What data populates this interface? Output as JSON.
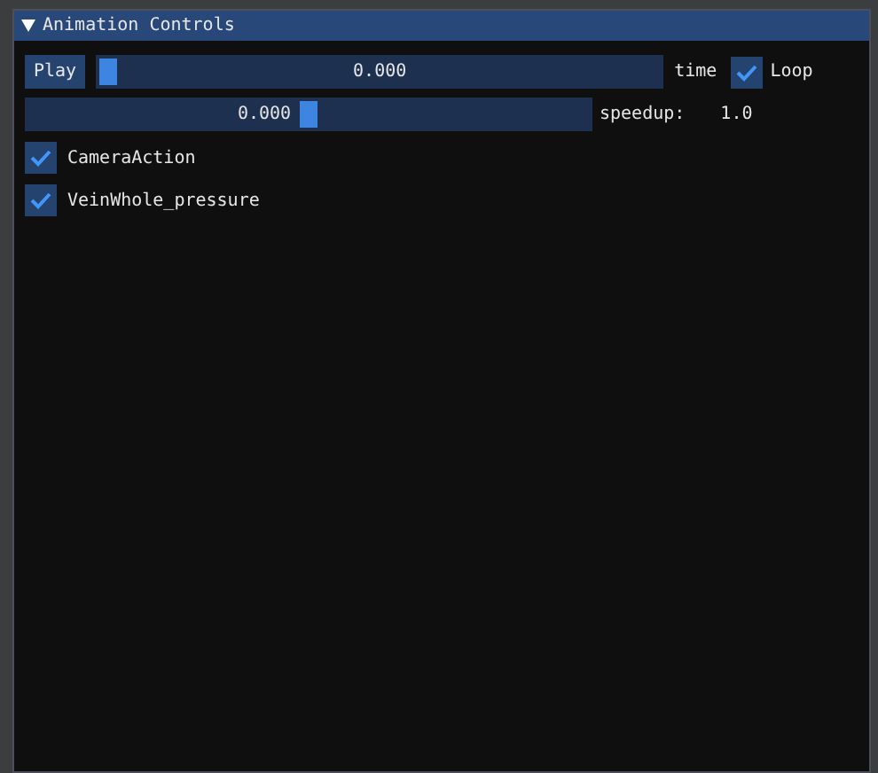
{
  "window": {
    "title": "Animation Controls",
    "expanded": true
  },
  "play_button": {
    "label": "Play"
  },
  "time_slider": {
    "value": "0.000",
    "level": 0,
    "label": "time"
  },
  "loop": {
    "label": "Loop",
    "checked": true
  },
  "speed_slider": {
    "value": "0.000",
    "level": 0.5,
    "label": "speedup:",
    "reading": "1.0"
  },
  "actions": [
    {
      "label": "CameraAction",
      "checked": true
    },
    {
      "label": "VeinWhole_pressure",
      "checked": true
    }
  ]
}
